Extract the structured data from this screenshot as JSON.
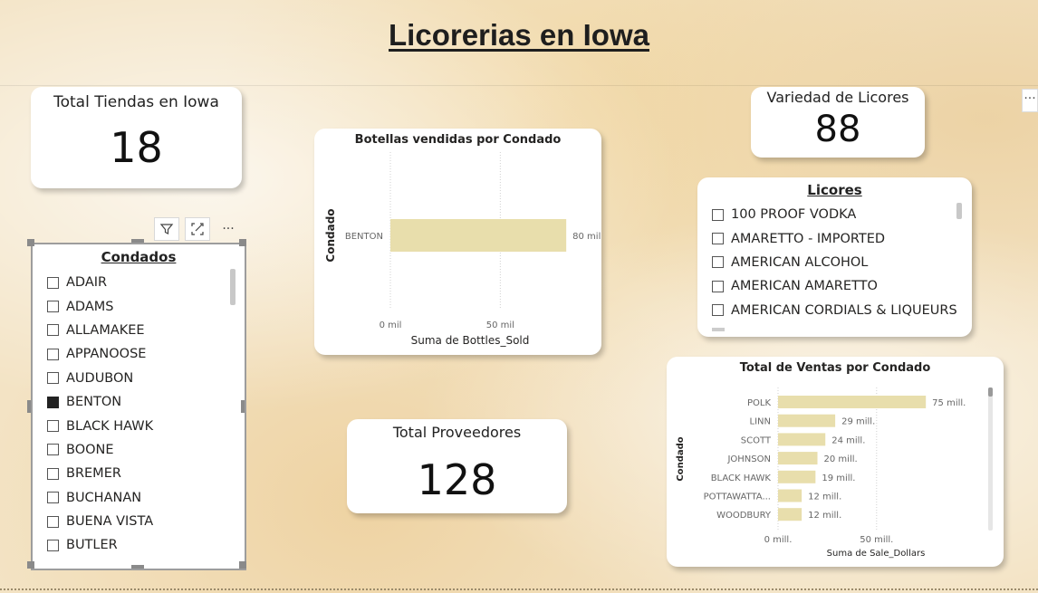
{
  "page_title": "Licorerias en Iowa",
  "kpi_tiendas": {
    "label": "Total Tiendas en Iowa",
    "value": "18"
  },
  "kpi_licores": {
    "label": "Variedad de Licores",
    "value": "88"
  },
  "kpi_proveedores": {
    "label": "Total Proveedores",
    "value": "128"
  },
  "condados_slicer": {
    "title": "Condados",
    "items": [
      {
        "label": "ADAIR",
        "checked": false
      },
      {
        "label": "ADAMS",
        "checked": false
      },
      {
        "label": "ALLAMAKEE",
        "checked": false
      },
      {
        "label": "APPANOOSE",
        "checked": false
      },
      {
        "label": "AUDUBON",
        "checked": false
      },
      {
        "label": "BENTON",
        "checked": true
      },
      {
        "label": "BLACK HAWK",
        "checked": false
      },
      {
        "label": "BOONE",
        "checked": false
      },
      {
        "label": "BREMER",
        "checked": false
      },
      {
        "label": "BUCHANAN",
        "checked": false
      },
      {
        "label": "BUENA VISTA",
        "checked": false
      },
      {
        "label": "BUTLER",
        "checked": false
      }
    ]
  },
  "visual_toolbar": {
    "filter_icon": "filter-icon",
    "focus_icon": "focus-mode-icon",
    "more_icon": "more-options-icon",
    "more_label": "···"
  },
  "licores_slicer": {
    "title": "Licores",
    "items": [
      {
        "label": "100 PROOF VODKA",
        "checked": false
      },
      {
        "label": "AMARETTO - IMPORTED",
        "checked": false
      },
      {
        "label": "AMERICAN ALCOHOL",
        "checked": false
      },
      {
        "label": "AMERICAN AMARETTO",
        "checked": false
      },
      {
        "label": "AMERICAN CORDIALS & LIQUEURS",
        "checked": false
      }
    ]
  },
  "chart_data": [
    {
      "type": "bar",
      "orientation": "horizontal",
      "title": "Botellas vendidas por Condado",
      "xlabel": "Suma de Bottles_Sold",
      "ylabel": "Condado",
      "categories": [
        "BENTON"
      ],
      "values": [
        80000
      ],
      "data_labels": [
        "80 mil"
      ],
      "xticks": [
        0,
        50000
      ],
      "xtick_labels": [
        "0 mil",
        "50 mil"
      ],
      "xlim": [
        0,
        89000
      ],
      "bar_color": "#e8deac",
      "grid": "vertical dotted"
    },
    {
      "type": "bar",
      "orientation": "horizontal",
      "title": "Total de Ventas por Condado",
      "xlabel": "Suma de Sale_Dollars",
      "ylabel": "Condado",
      "categories": [
        "POLK",
        "LINN",
        "SCOTT",
        "JOHNSON",
        "BLACK HAWK",
        "POTTAWATTA...",
        "WOODBURY"
      ],
      "values": [
        75000000,
        29000000,
        24000000,
        20000000,
        19000000,
        12000000,
        12000000
      ],
      "data_labels": [
        "75 mill.",
        "29 mill.",
        "24 mill.",
        "20 mill.",
        "19 mill.",
        "12 mill.",
        "12 mill."
      ],
      "xticks": [
        0,
        50000000
      ],
      "xtick_labels": [
        "0 mill.",
        "50 mill."
      ],
      "xlim": [
        0,
        91000000
      ],
      "bar_color": "#e8deac",
      "grid": "vertical dotted"
    }
  ]
}
